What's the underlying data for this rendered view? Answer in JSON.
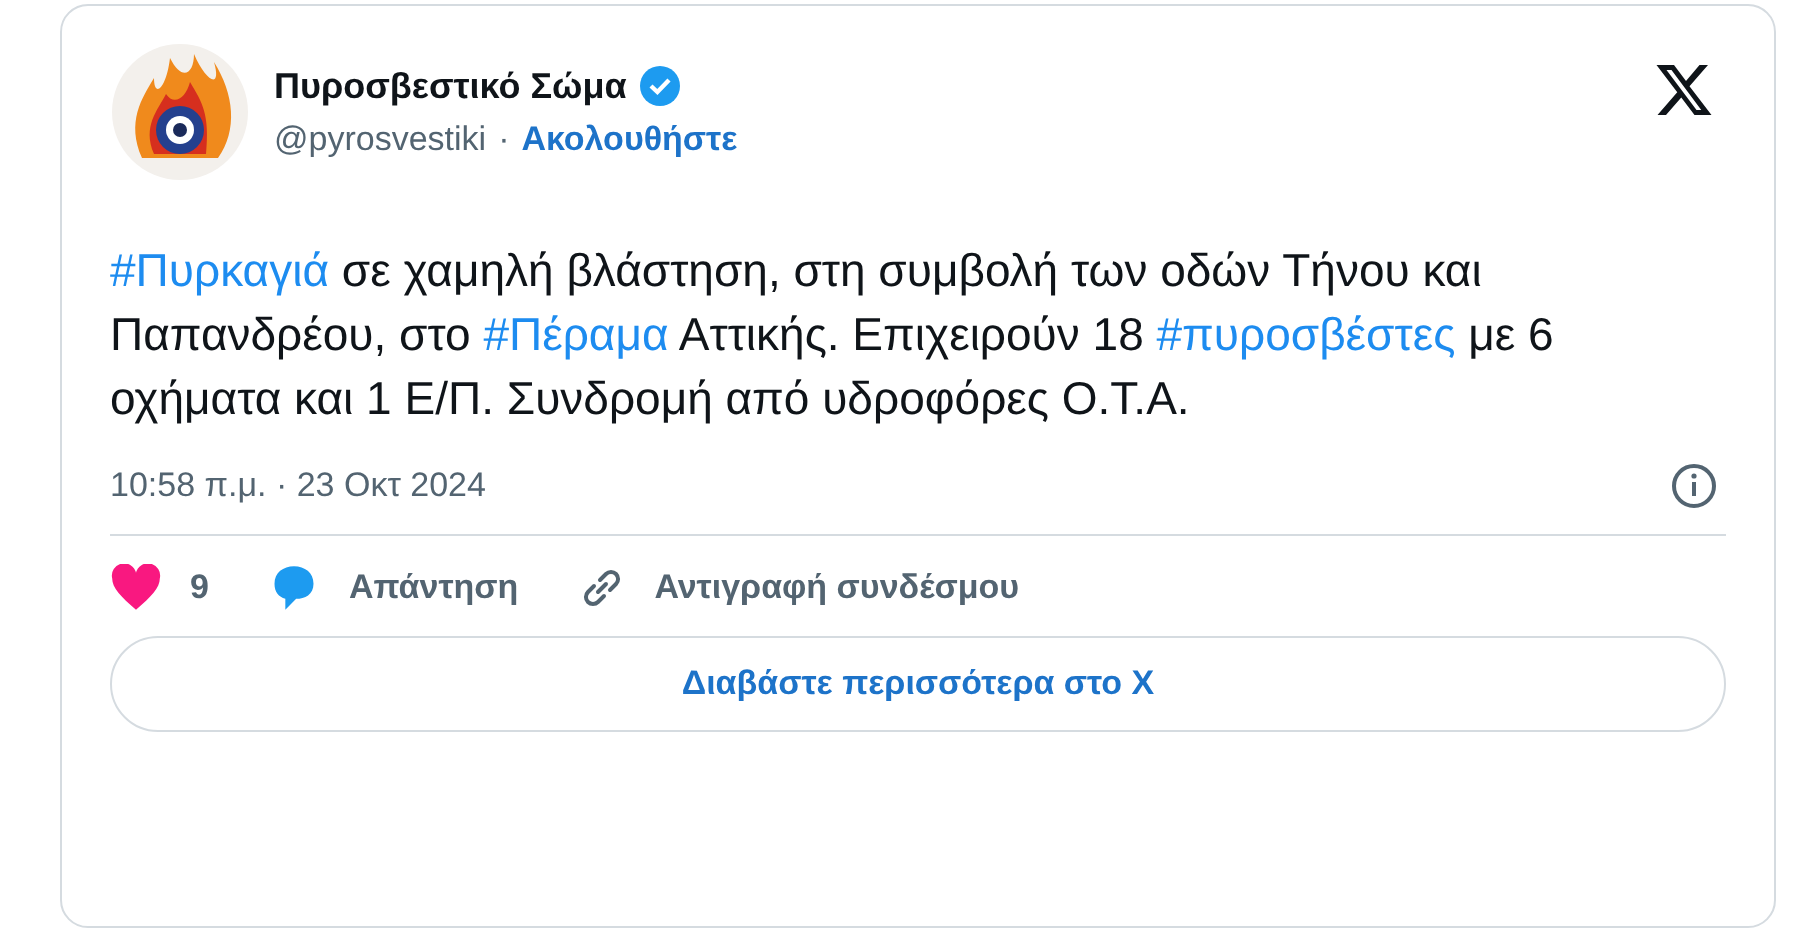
{
  "author": {
    "name": "Πυροσβεστικό Σώμα",
    "verified": true,
    "handle": "@pyrosvestiki",
    "separator": "·",
    "follow": "Ακολουθήστε"
  },
  "body": [
    {
      "kind": "hashtag",
      "text": "#Πυρκαγιά"
    },
    {
      "kind": "plain",
      "text": " σε χαμηλή βλάστηση, στη συμβολή των οδών Τήνου και Παπανδρέου, στο "
    },
    {
      "kind": "hashtag",
      "text": "#Πέραμα"
    },
    {
      "kind": "plain",
      "text": " Αττικής. Επιχειρούν 18 "
    },
    {
      "kind": "hashtag",
      "text": "#πυροσβέστες"
    },
    {
      "kind": "plain",
      "text": " με 6 οχήματα και 1 Ε/Π. Συνδρομή από υδροφόρες Ο.Τ.Α."
    }
  ],
  "timestamp": "10:58 π.μ. · 23 Οκτ 2024",
  "actions": [
    {
      "kind": "like",
      "label": "9"
    },
    {
      "kind": "reply",
      "label": "Απάντηση"
    },
    {
      "kind": "copy",
      "label": "Αντιγραφή συνδέσμου"
    }
  ],
  "read_more": "Διαβάστε περισσότερα στο X"
}
